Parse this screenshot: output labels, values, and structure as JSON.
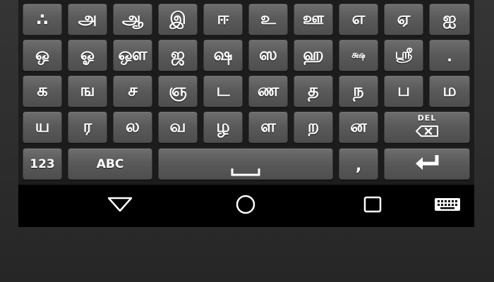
{
  "keyboard": {
    "row1": [
      "∴",
      "அ",
      "ஆ",
      "இ",
      "ஈ",
      "உ",
      "ஊ",
      "எ",
      "ஏ",
      "ஐ"
    ],
    "row2": [
      "ஒ",
      "ஓ",
      "ஔ",
      "ஜ",
      "ஷ",
      "ஸ",
      "ஹ",
      "க்ஷ",
      "ஶ்ரீ",
      "."
    ],
    "row3": [
      "க",
      "ங",
      "ச",
      "ஞ",
      "ட",
      "ண",
      "த",
      "ந",
      "ப",
      "ம"
    ],
    "row4": [
      "ய",
      "ர",
      "ல",
      "வ",
      "ழ",
      "ள",
      "ற",
      "ன"
    ],
    "del_label": "DEL",
    "num_label": "123",
    "abc_label": "ABC",
    "comma_label": ","
  },
  "icons": {
    "backspace": "backspace-icon",
    "space": "space-bar-icon",
    "enter": "enter-arrow-icon",
    "back": "triangle-back-icon",
    "home": "circle-home-icon",
    "recents": "square-recents-icon",
    "keyboard_switch": "keyboard-icon"
  },
  "colors": {
    "key_top": "#6e6e6e",
    "key_bottom": "#4e4e4e",
    "keyboard_bg": "#1c1c1c",
    "navbar_bg": "#000000",
    "key_text": "#ffffff"
  }
}
